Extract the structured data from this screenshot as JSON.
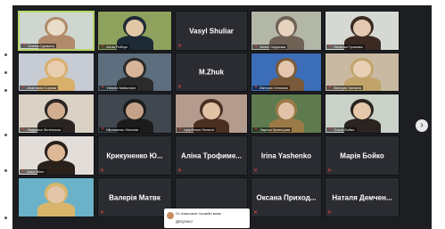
{
  "participants": [
    {
      "name": "Олена Сурмаль",
      "view": "video",
      "active": true
    },
    {
      "name": "Алла Рибчук",
      "view": "video"
    },
    {
      "name": "Vasyl Shuliar",
      "view": "name"
    },
    {
      "name": "Аліна Сіфукова",
      "view": "video"
    },
    {
      "name": "Наталья Громова",
      "view": "video"
    },
    {
      "name": "Анастасія Сорока",
      "view": "video"
    },
    {
      "name": "Viktoria Malkovska",
      "view": "video"
    },
    {
      "name": "M.Zhuk",
      "view": "name"
    },
    {
      "name": "Вікторія Олексюк",
      "view": "video"
    },
    {
      "name": "Вікторія Гречана",
      "view": "video"
    },
    {
      "name": "Людмила Зеленська",
      "view": "video"
    },
    {
      "name": "Мірошенко Наталія",
      "view": "video"
    },
    {
      "name": "Щербенко Наталя",
      "view": "video"
    },
    {
      "name": "Лариса Кузнєцова",
      "view": "video"
    },
    {
      "name": "Ольга Бойко",
      "view": "video"
    },
    {
      "name": "Anna Bilan",
      "view": "video"
    },
    {
      "name": "Крикуненко Ю...",
      "view": "name"
    },
    {
      "name": "Аліна Трофиме...",
      "view": "name"
    },
    {
      "name": "Irina Yashenko",
      "view": "name"
    },
    {
      "name": "Марія Бойко",
      "view": "name"
    },
    {
      "name": "",
      "view": "video"
    },
    {
      "name": "Валерія Матвк",
      "view": "name"
    },
    {
      "name": "",
      "view": "empty"
    },
    {
      "name": "Оксана Приход...",
      "view": "name"
    },
    {
      "name": "Наталя Демчен...",
      "view": "name"
    }
  ],
  "chat": {
    "sender": "От Анастасія Сьомбін всем",
    "message": "Дякуємо!"
  },
  "icons": {
    "muted": "mic-muted-icon",
    "next": "chevron-right-icon"
  },
  "colors": {
    "background": "#1d1e22",
    "tile": "#2b2c31",
    "active_border": "#b9d86a",
    "muted_red": "#e54343"
  }
}
